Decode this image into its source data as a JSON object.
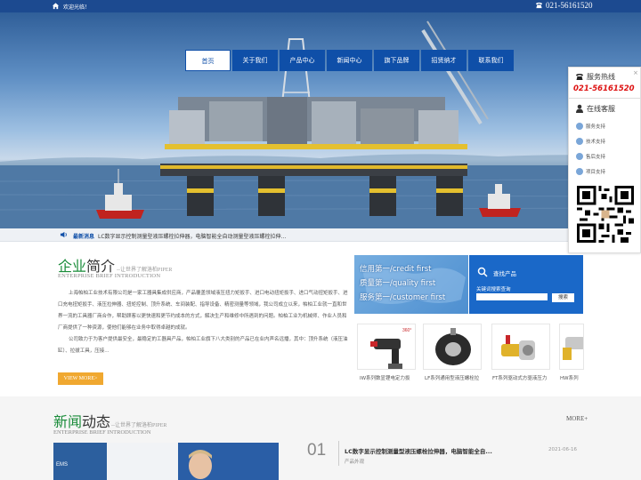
{
  "topbar": {
    "welcome": "欢迎光临！",
    "phone": "021-56161520"
  },
  "nav": {
    "items": [
      {
        "label": "首页",
        "active": true
      },
      {
        "label": "关于我们",
        "active": false
      },
      {
        "label": "产品中心",
        "active": false
      },
      {
        "label": "新闻中心",
        "active": false
      },
      {
        "label": "旗下品牌",
        "active": false
      },
      {
        "label": "招贤纳才",
        "active": false
      },
      {
        "label": "联系我们",
        "active": false
      }
    ]
  },
  "newsbar": {
    "label": "最新消息",
    "text": "LC数字显示控制测量型液压螺栓拉伸器，电脑智能全自动测量型液压螺栓拉伸..."
  },
  "about": {
    "title_a": "企业",
    "title_b": "简介",
    "subtitle": "--让世界了解洛柏PIPER",
    "english": "ENTERPRISE BRIEF INTRODUCTION",
    "para1": "上海帕柏工业技术有限公司是一家工器具集成供应商，产品覆盖领域液压扭力矩扳手、进口电动扭矩扳手、进口气动扭矩扳手、进口充电扭矩扳手、液压拉伸器、扭矩控制、顶升系统、车间装配、指导设备、精密测量等领域，我公司成立以来，帕柏工业就一直和世界一流的工具器厂商合作，帮助顾客以更快速和更节约成本的方式，解决生产和维修中所遇到的问题。帕柏工业为机械师、作业人员和厂商提供了一种资源，使他们能够在业务中取得卓越的成就。",
    "para2": "公司致力于为客户提供最安全，最稳定的工器具产品，帕柏工业旗下八大类别的产品已在业内声名远播，其中：顶升系统（液压油缸）、拉拔工具，压接...",
    "viewmore": "VIEW MORE>"
  },
  "banner": {
    "lines": [
      "信用第一/credit first",
      "质量第一/quality first",
      "服务第一/customer first"
    ]
  },
  "search": {
    "title": "查找产品",
    "keyword_label": "关键词搜索查询",
    "input_placeholder": "",
    "button": "搜索"
  },
  "products": [
    {
      "label": "IW系列数显锂电定力扳"
    },
    {
      "label": "LF系列通用型液压螺栓拉"
    },
    {
      "label": "FT系列驱动式方驱液压力"
    },
    {
      "label": "HW系列"
    }
  ],
  "news": {
    "title_a": "新闻",
    "title_b": "动态",
    "subtitle": "--让世界了解洛柏PIPER",
    "english": "ENTERPRISE BRIEF INTRODUCTION",
    "more": "MORE+",
    "item": {
      "num": "01",
      "title": "LC数字显示控制测量型液压螺栓拉伸器，电脑智能全自...",
      "date": "2021-06-16",
      "category": "产品外观"
    }
  },
  "sidepanel": {
    "close": "×",
    "hotline_label": "服务热线",
    "hotline_number": "021-56161520",
    "service_label": "在线客服",
    "items": [
      "服务支持",
      "技术支持",
      "售后支持",
      "项目支持"
    ]
  },
  "colors": {
    "brand_blue": "#0f4fa8",
    "topbar": "#1c4a90",
    "accent_green": "#1a8c3a",
    "button_orange": "#f0a830",
    "hotline_red": "#d11111"
  }
}
